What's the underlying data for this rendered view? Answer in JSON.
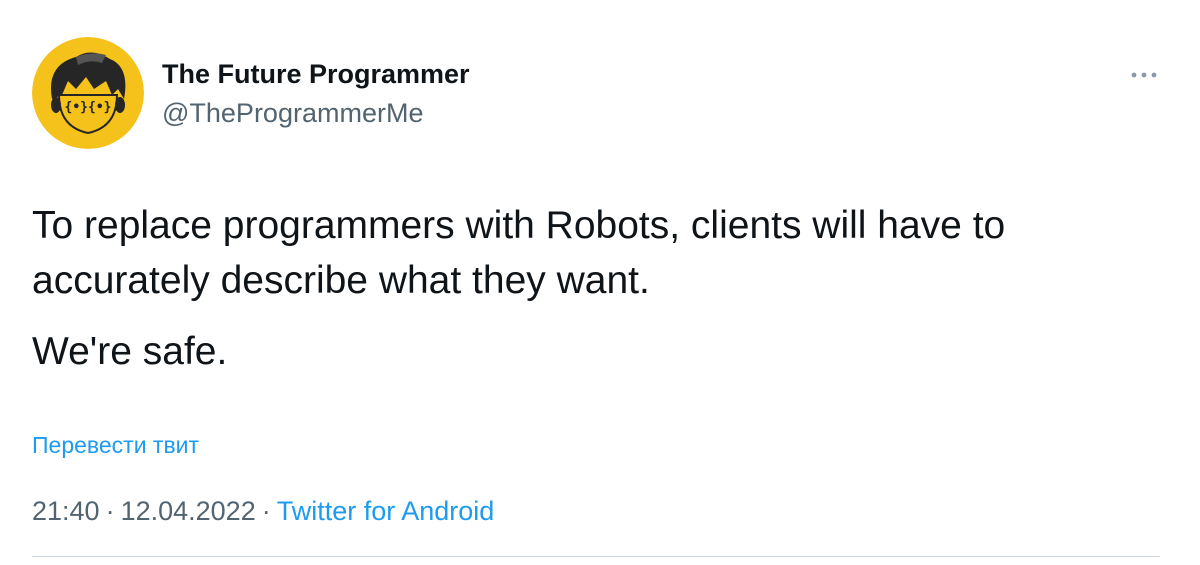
{
  "tweet": {
    "author": {
      "display_name": "The Future Programmer",
      "handle": "@TheProgrammerMe",
      "avatar": "cartoon-face-with-curly-brace-glasses",
      "avatar_glyph": "{•}{•}"
    },
    "more_icon": "more-options-icon",
    "body": {
      "line1": "To replace programmers with Robots, clients will have to accurately describe what they want.",
      "line2": "We're safe."
    },
    "translate_link": "Перевести твит",
    "meta": {
      "time": "21:40",
      "date": "12.04.2022",
      "separator": "·",
      "source": "Twitter for Android"
    }
  },
  "colors": {
    "text_primary": "#0f1419",
    "text_secondary": "#536471",
    "link": "#1d9bf0",
    "avatar_bg": "#f4c21b",
    "avatar_hair": "#262626",
    "divider": "#cfd9de"
  }
}
